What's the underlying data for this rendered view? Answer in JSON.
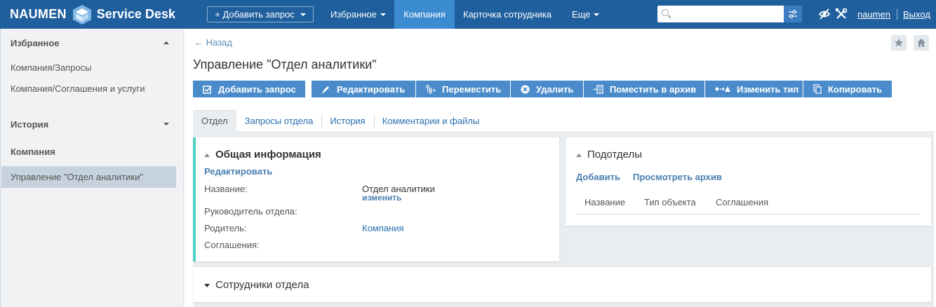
{
  "topbar": {
    "logo_left": "NAUMEN",
    "logo_right": "Service Desk",
    "add_request": "+ Добавить запрос",
    "nav": [
      "Избранное",
      "Компания",
      "Карточка сотрудника",
      "Еще"
    ],
    "active_nav": "Компания",
    "search_placeholder": "",
    "user": "naumen",
    "logout": "Выход"
  },
  "sidebar": {
    "favorites_title": "Избранное",
    "favorites": [
      "Компания/Запросы",
      "Компания/Соглашения и услуги"
    ],
    "history_title": "История",
    "history": [
      "Компания",
      "Управление \"Отдел аналитики\""
    ]
  },
  "page": {
    "back": "Назад",
    "title": "Управление \"Отдел аналитики\""
  },
  "toolbar": [
    "Добавить запрос",
    "Редактировать",
    "Переместить",
    "Удалить",
    "Поместить в архив",
    "Изменить тип",
    "Копировать"
  ],
  "tabs": [
    "Отдел",
    "Запросы отдела",
    "История",
    "Комментарии и файлы"
  ],
  "active_tab": "Отдел",
  "general": {
    "title": "Общая информация",
    "edit": "Редактировать",
    "name_label": "Название:",
    "name_value": "Отдел аналитики",
    "change": "изменить",
    "head_label": "Руководитель отдела:",
    "parent_label": "Родитель:",
    "parent_value": "Компания",
    "agreements_label": "Соглашения:"
  },
  "subdivisions": {
    "title": "Подотделы",
    "add": "Добавить",
    "archive": "Просмотреть архив",
    "columns": [
      "Название",
      "Тип объекта",
      "Соглашения"
    ]
  },
  "employees": {
    "title": "Сотрудники отдела"
  },
  "colors": {
    "topbar": "#1f5f9e",
    "nav_active": "#3b8bd0",
    "button": "#4a8ccb",
    "accent_border": "#4fd1c5"
  }
}
